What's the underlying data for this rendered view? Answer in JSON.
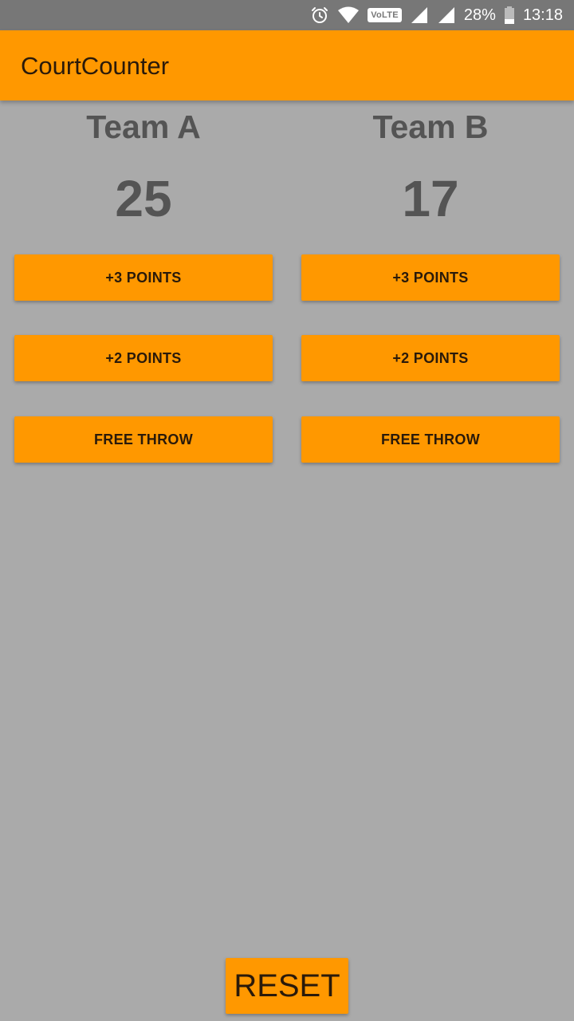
{
  "status_bar": {
    "battery": "28%",
    "time": "13:18",
    "volte_label": "VoLTE",
    "icons": [
      "alarm-icon",
      "wifi-icon",
      "volte-icon",
      "signal-icon",
      "signal-icon",
      "battery-icon"
    ]
  },
  "app_bar": {
    "title": "CourtCounter",
    "color": "#ff9800"
  },
  "teams": [
    {
      "name": "Team A",
      "score": "25",
      "buttons": {
        "three": "+3 POINTS",
        "two": "+2 POINTS",
        "free_throw": "FREE THROW"
      }
    },
    {
      "name": "Team B",
      "score": "17",
      "buttons": {
        "three": "+3 POINTS",
        "two": "+2 POINTS",
        "free_throw": "FREE THROW"
      }
    }
  ],
  "reset_label": "RESET",
  "colors": {
    "accent": "#ff9800",
    "background": "#aaaaaa",
    "status_bar": "#777777",
    "score_text": "#545454"
  }
}
